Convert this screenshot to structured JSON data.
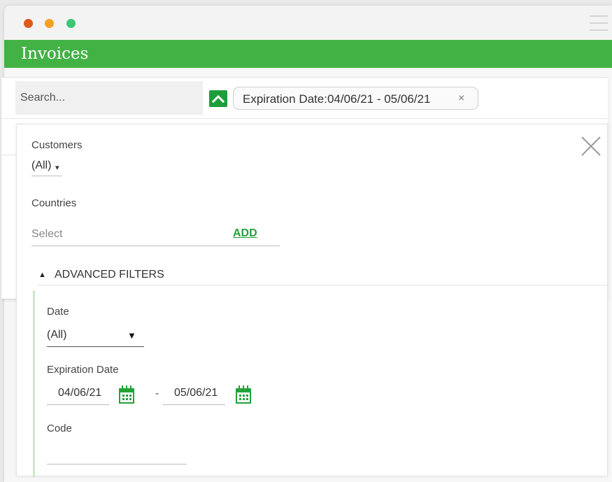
{
  "window": {
    "title": "Invoices"
  },
  "colors": {
    "accent": "#43b245",
    "button_green": "#1e9e3a",
    "link_green": "#22a33a",
    "dot_red": "#dc5a1c",
    "dot_yellow": "#f2a223",
    "dot_green": "#3bc577"
  },
  "search": {
    "placeholder": "Search..."
  },
  "active_filter_chip": {
    "label": "Expiration Date:04/06/21 - 05/06/21",
    "close_symbol": "×"
  },
  "filters": {
    "customers": {
      "label": "Customers",
      "value": "(All)",
      "arrow": "▾"
    },
    "countries": {
      "label": "Countries",
      "placeholder": "Select",
      "add_label": "ADD"
    },
    "advanced": {
      "toggle_symbol": "▲",
      "label": "ADVANCED FILTERS",
      "date": {
        "label": "Date",
        "value": "(All)",
        "arrow": "▼"
      },
      "expiration_date": {
        "label": "Expiration Date",
        "from": "04/06/21",
        "separator": "-",
        "to": "05/06/21"
      },
      "code": {
        "label": "Code",
        "value": ""
      }
    }
  },
  "icons": {
    "close_panel": "close-icon",
    "collapse": "chevron-up-icon",
    "calendar": "calendar-icon",
    "menu": "hamburger-menu-icon"
  }
}
